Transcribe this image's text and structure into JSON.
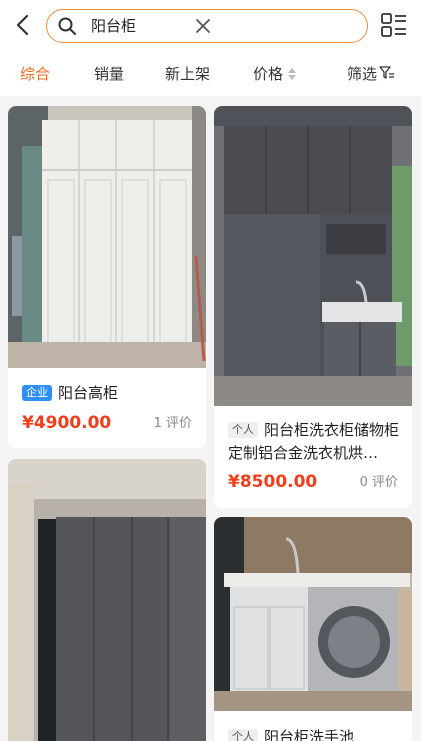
{
  "search": {
    "query": "阳台柜"
  },
  "filters": [
    {
      "label": "综合",
      "active": true
    },
    {
      "label": "销量"
    },
    {
      "label": "新上架"
    },
    {
      "label": "价格"
    },
    {
      "label": "筛选"
    }
  ],
  "products": [
    {
      "tag": "企业",
      "title": "阳台高柜",
      "price": "¥4900.00",
      "reviews": "1 评价"
    },
    {
      "tag": "个人",
      "title": "阳台柜洗衣柜储物柜定制铝合金洗衣机烘…",
      "price": "¥8500.00",
      "reviews": "0 评价"
    },
    {
      "tag": "",
      "title": "",
      "price": "",
      "reviews": ""
    },
    {
      "tag": "个人",
      "title": "阳台柜洗手池",
      "price": "",
      "reviews": ""
    }
  ],
  "colors": {
    "accent": "#f56a1c",
    "search_border": "#f08a36",
    "price": "#f03d1b",
    "biz_tag": "#2f8ff0"
  }
}
